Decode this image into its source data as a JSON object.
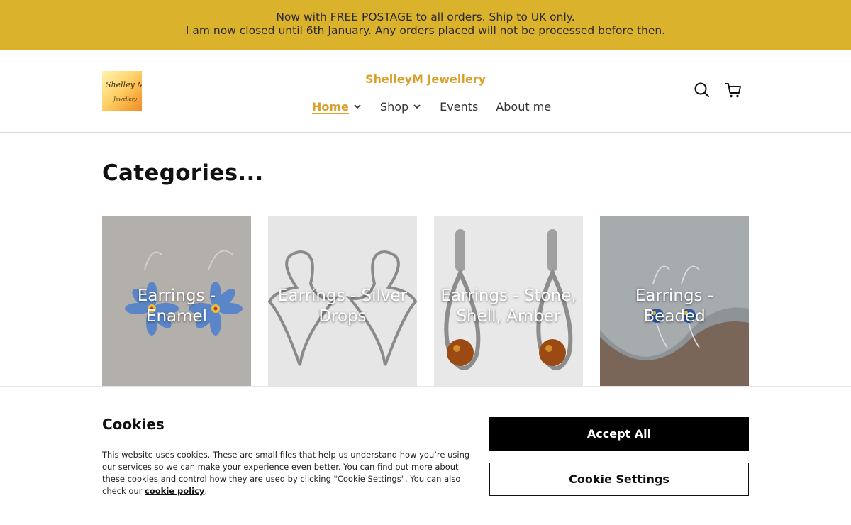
{
  "announcement": {
    "line1": "Now with FREE POSTAGE to all orders. Ship to UK only.",
    "line2": "I am now closed until 6th January. Any orders placed will not be processed before then."
  },
  "header": {
    "logo_line1": "Shelley M",
    "logo_line2": "Jewellery",
    "brand": "ShelleyM Jewellery",
    "nav": [
      {
        "label": "Home",
        "has_dropdown": true,
        "active": true
      },
      {
        "label": "Shop",
        "has_dropdown": true,
        "active": false
      },
      {
        "label": "Events",
        "has_dropdown": false,
        "active": false
      },
      {
        "label": "About me",
        "has_dropdown": false,
        "active": false
      }
    ],
    "icons": [
      "search-icon",
      "cart-icon"
    ]
  },
  "main": {
    "heading": "Categories...",
    "categories": [
      {
        "label": "Earrings - Enamel",
        "image": "blue enamel flower earrings on grey stone"
      },
      {
        "label": "Earrings - Silver Drops",
        "image": "silver heart drop earrings on light grey"
      },
      {
        "label": "Earrings - Stone, Shell, Amber",
        "image": "silver amber drop earrings on light grey"
      },
      {
        "label": "Earrings - Beaded",
        "image": "beaded glass drop earrings on slate"
      }
    ]
  },
  "cookie_banner": {
    "title": "Cookies",
    "text": "This website uses cookies. These are small files that help us understand how you’re using our services so we can make your experience even better. You can find out more about these cookies and control how they are used by clicking \"Cookie Settings\". You can also check our",
    "link": "cookie policy",
    "end": ".",
    "accept_label": "Accept All",
    "settings_label": "Cookie Settings"
  },
  "colors": {
    "announcement_bg": "#dbb22b",
    "accent": "#d9a02a",
    "accept_bg": "#000000"
  }
}
